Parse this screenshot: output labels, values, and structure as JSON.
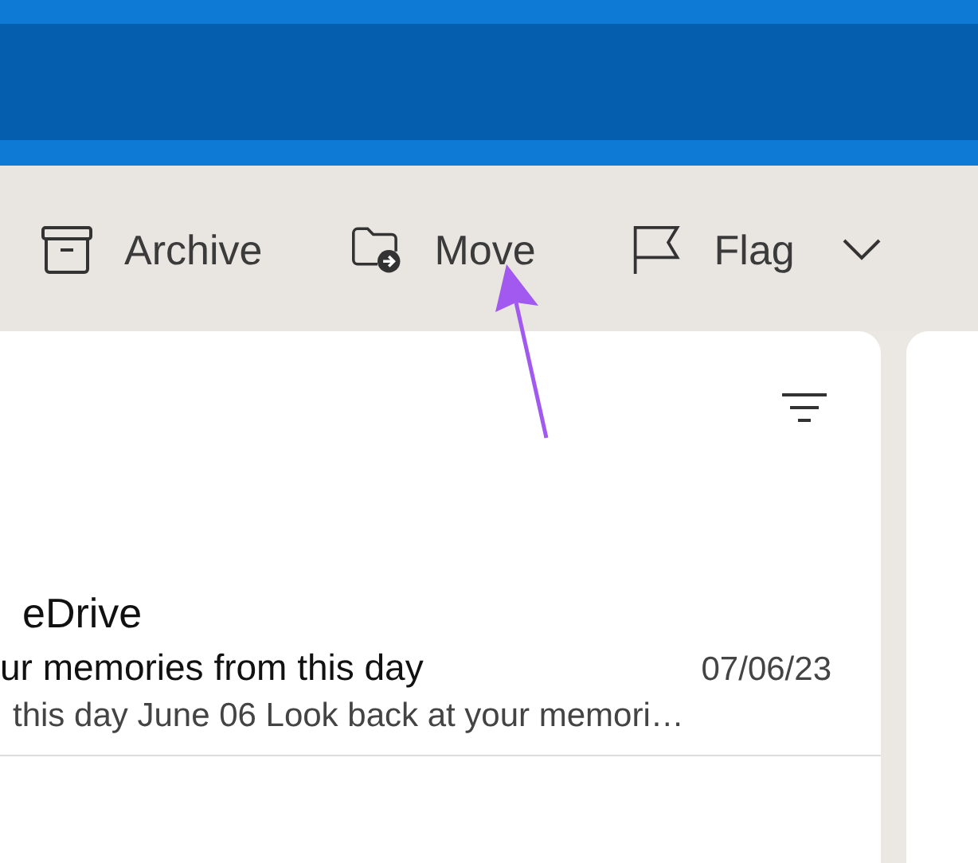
{
  "toolbar": {
    "items": [
      {
        "kind": "archive",
        "label": "Archive"
      },
      {
        "kind": "move",
        "label": "Move"
      },
      {
        "kind": "flag",
        "label": "Flag"
      }
    ]
  },
  "message_list": {
    "messages": [
      {
        "sender": "eDrive",
        "subject": "ur memories from this day",
        "date": "07/06/23",
        "preview": "this day June 06 Look back at your memori…"
      }
    ]
  },
  "annotation": {
    "kind": "arrow"
  }
}
